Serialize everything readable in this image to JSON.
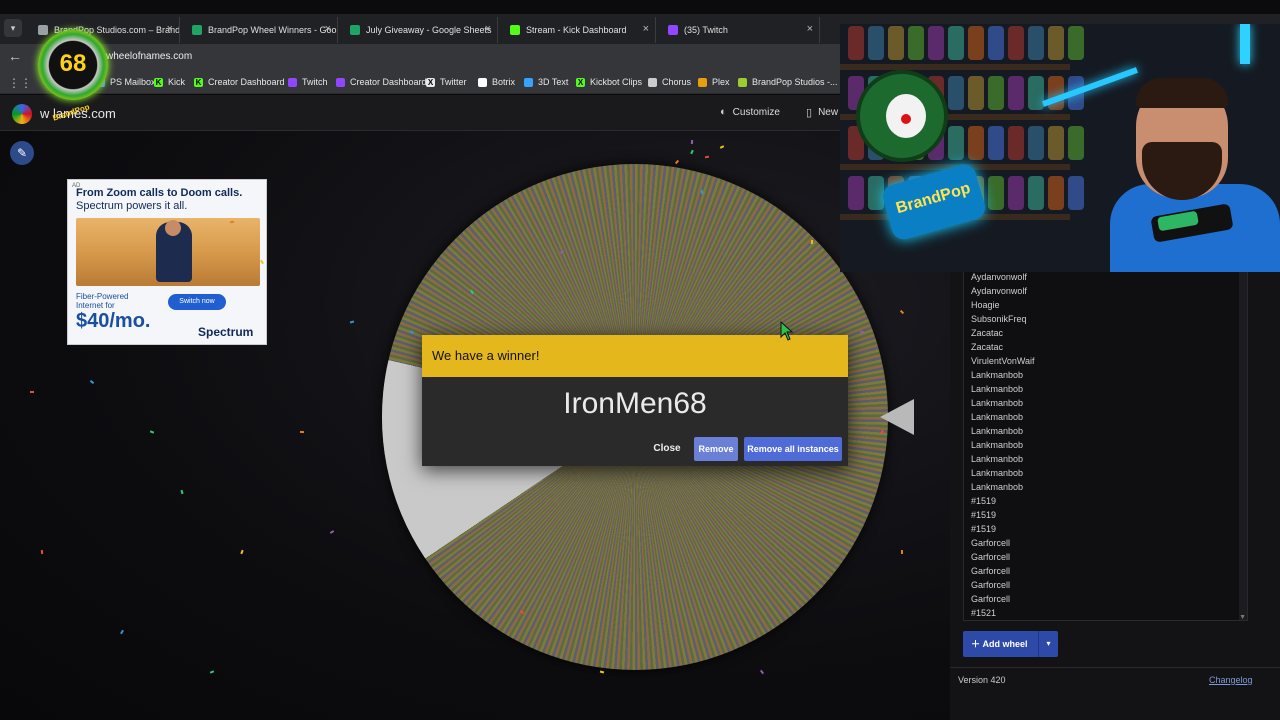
{
  "browser": {
    "tabs": [
      {
        "label": "BrandPop Studios.com – BrandP",
        "fav_color": "#9aa0a6"
      },
      {
        "label": "BrandPop Wheel Winners - Goo",
        "fav_color": "#1fa463"
      },
      {
        "label": "July Giveaway - Google Sheets",
        "fav_color": "#1fa463"
      },
      {
        "label": "Stream - Kick Dashboard",
        "fav_color": "#53fc18"
      },
      {
        "label": "(35) Twitch",
        "fav_color": "#9146ff"
      }
    ],
    "url": "wheelofnames.com",
    "bookmarks": [
      {
        "label": "PS Mailbox",
        "color": "#4285f4",
        "glyph": ""
      },
      {
        "label": "Kick",
        "color": "#53fc18",
        "glyph": "K"
      },
      {
        "label": "Creator Dashboard",
        "color": "#53fc18",
        "glyph": "K"
      },
      {
        "label": "Twitch",
        "color": "#9146ff",
        "glyph": ""
      },
      {
        "label": "Creator Dashboard",
        "color": "#9146ff",
        "glyph": ""
      },
      {
        "label": "Twitter",
        "color": "#e8e8e8",
        "glyph": "X"
      },
      {
        "label": "Botrix",
        "color": "#ffffff",
        "glyph": ""
      },
      {
        "label": "3D Text",
        "color": "#36a3ff",
        "glyph": ""
      },
      {
        "label": "Kickbot Clips",
        "color": "#53fc18",
        "glyph": "X"
      },
      {
        "label": "Chorus",
        "color": "#cccccc",
        "glyph": ""
      },
      {
        "label": "Plex",
        "color": "#e5a00d",
        "glyph": ""
      },
      {
        "label": "BrandPop Studios -...",
        "color": "#9acd32",
        "glyph": ""
      }
    ]
  },
  "site": {
    "name_visible": "w   lames.com",
    "customize_label": "Customize",
    "new_label": "New"
  },
  "ad": {
    "tag": "AD",
    "headline": "From Zoom calls to Doom calls.",
    "subline": "Spectrum powers it all.",
    "line1": "Fiber-Powered",
    "line2": "Internet for",
    "price": "$40/mo.",
    "button": "Switch now",
    "brand": "Spectrum"
  },
  "dialog": {
    "title": "We have a winner!",
    "winner": "IronMen68",
    "close_label": "Close",
    "remove_label": "Remove",
    "remove_all_label": "Remove all instances"
  },
  "entries": [
    "Aydanvonwolf",
    "Aydanvonwolf",
    "Hoagie",
    "SubsonikFreq",
    "Zacatac",
    "Zacatac",
    "VirulentVonWaif",
    "Lankmanbob",
    "Lankmanbob",
    "Lankmanbob",
    "Lankmanbob",
    "Lankmanbob",
    "Lankmanbob",
    "Lankmanbob",
    "Lankmanbob",
    "Lankmanbob",
    "#1519",
    "#1519",
    "#1519",
    "Garforcell",
    "Garforcell",
    "Garforcell",
    "Garforcell",
    "Garforcell",
    "#1521"
  ],
  "panel": {
    "add_wheel_label": "Add wheel",
    "version": "Version 420",
    "changelog": "Changelog"
  },
  "overlay": {
    "badge_number": "68",
    "badge_text": "BrandPop",
    "sign_text": "BrandPop"
  }
}
